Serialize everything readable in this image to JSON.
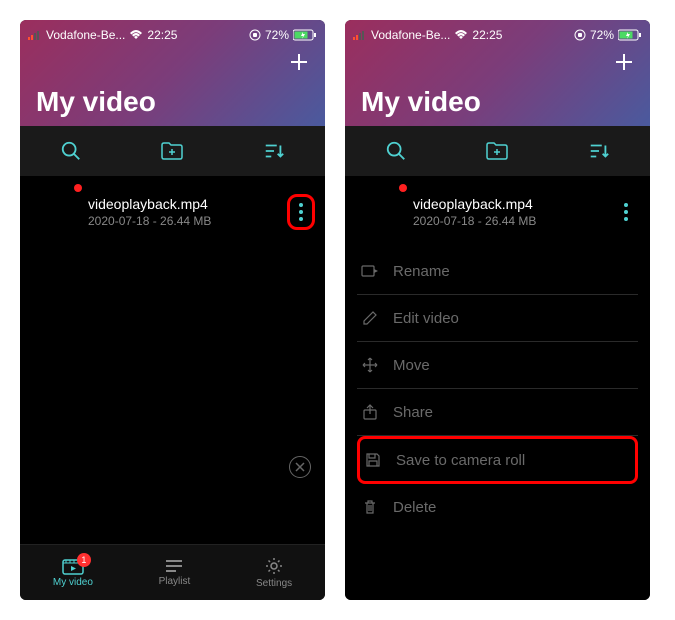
{
  "statusBar": {
    "carrier": "Vodafone-Be...",
    "time": "22:25",
    "battery": "72%"
  },
  "header": {
    "title": "My video"
  },
  "file": {
    "name": "videoplayback.mp4",
    "meta": "2020-07-18 - 26.44 MB"
  },
  "tabs": {
    "myvideo": "My video",
    "playlist": "Playlist",
    "settings": "Settings",
    "badge": "1"
  },
  "menu": {
    "rename": "Rename",
    "edit": "Edit video",
    "move": "Move",
    "share": "Share",
    "save": "Save to camera roll",
    "delete": "Delete"
  }
}
